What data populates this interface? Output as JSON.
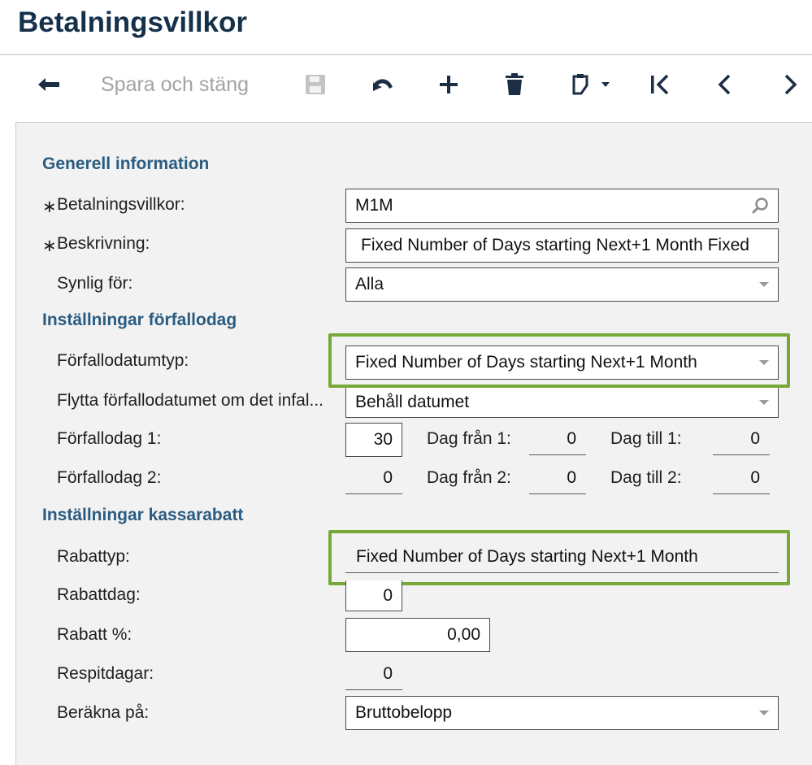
{
  "page_title": "Betalningsvillkor",
  "toolbar": {
    "back_icon": "back-arrow-icon",
    "save_close_label": "Spara och stäng",
    "save_icon": "floppy-disk-icon",
    "undo_icon": "undo-icon",
    "add_icon": "plus-icon",
    "delete_icon": "trash-icon",
    "copy_icon": "clipboard-icon",
    "first_icon": "first-record-icon",
    "prev_icon": "chevron-left-icon",
    "next_icon": "chevron-right-icon"
  },
  "general": {
    "section_title": "Generell information",
    "terms_label": "Betalningsvillkor:",
    "terms_value": "M1M",
    "description_label": "Beskrivning:",
    "description_value": "Fixed Number of Days starting Next+1 Month Fixed",
    "visible_label": "Synlig för:",
    "visible_value": "Alla",
    "required_mark": "∗"
  },
  "due": {
    "section_title": "Inställningar förfallodag",
    "due_type_label": "Förfallodatumtyp:",
    "due_type_value": "Fixed Number of Days starting Next+1 Month",
    "move_label": "Flytta förfallodatumet om det infal...",
    "move_value": "Behåll datumet",
    "due_day1_label": "Förfallodag 1:",
    "due_day1_value": "30",
    "day_from1_label": "Dag från 1:",
    "day_from1_value": "0",
    "day_to1_label": "Dag till 1:",
    "day_to1_value": "0",
    "due_day2_label": "Förfallodag 2:",
    "due_day2_value": "0",
    "day_from2_label": "Dag från 2:",
    "day_from2_value": "0",
    "day_to2_label": "Dag till 2:",
    "day_to2_value": "0"
  },
  "discount": {
    "section_title": "Inställningar kassarabatt",
    "type_label": "Rabattyp:",
    "type_value": "Fixed Number of Days starting Next+1 Month",
    "day_label": "Rabattdag:",
    "day_value": "0",
    "percent_label": "Rabatt %:",
    "percent_value": "0,00",
    "grace_label": "Respitdagar:",
    "grace_value": "0",
    "calc_label": "Beräkna på:",
    "calc_value": "Bruttobelopp"
  },
  "colors": {
    "highlight": "#78a83a",
    "section": "#2a5c82",
    "title": "#15304a"
  }
}
